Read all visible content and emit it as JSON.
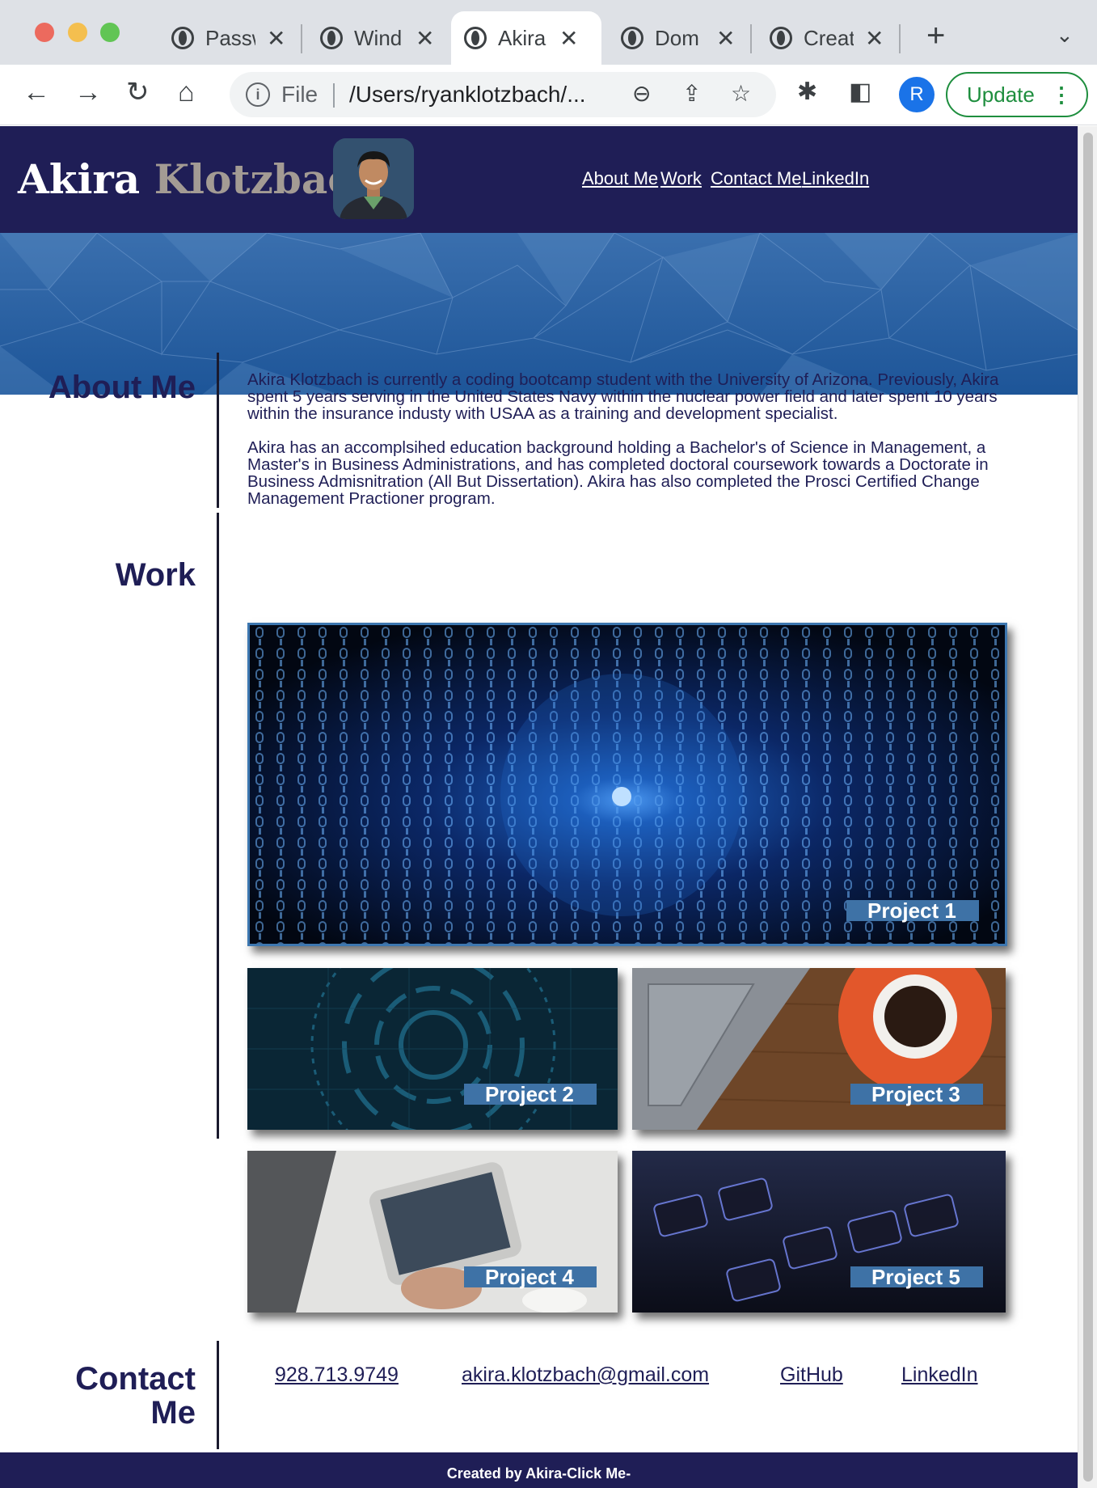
{
  "browser": {
    "tabs": [
      {
        "label": "Passw"
      },
      {
        "label": "Wind"
      },
      {
        "label": "Akira"
      },
      {
        "label": "Dom"
      },
      {
        "label": "Creat"
      }
    ],
    "address": {
      "scheme": "File",
      "url": "/Users/ryanklotzbach/..."
    },
    "update_label": "Update",
    "profile_initial": "R"
  },
  "site": {
    "brand_first": "Akira",
    "brand_last": "Klotzbach",
    "nav": [
      "About Me",
      "Work",
      "Contact Me",
      "LinkedIn"
    ],
    "about": {
      "title": "About Me",
      "paragraphs": [
        "Akira Klotzbach is currently a coding bootcamp student with the University of Arizona. Previously, Akira spent 5 years serving in the United States Navy within the nuclear power field and later spent 10 years within the insurance industy with USAA as a training and development specialist.",
        "Akira has an accomplsihed education background holding a Bachelor's of Science in Management, a Master's in Business Administrations, and has completed doctoral coursework towards a Doctorate in Business Admisnitration (All But Dissertation). Akira has also completed the Prosci Certified Change Management Practioner program."
      ]
    },
    "work": {
      "title": "Work",
      "projects": [
        "Project 1",
        "Project 2",
        "Project 3",
        "Project 4",
        "Project 5"
      ]
    },
    "contact": {
      "title_line1": "Contact",
      "title_line2": "Me",
      "links": [
        "928.713.9749",
        "akira.klotzbach@gmail.com",
        "GitHub",
        "LinkedIn"
      ]
    },
    "footer": "Created by Akira-Click Me-"
  },
  "colors": {
    "navy": "#1f1e56",
    "hero_blue": "#2460a7",
    "project_label": "#3e72a6",
    "update_green": "#1e8e3e"
  }
}
